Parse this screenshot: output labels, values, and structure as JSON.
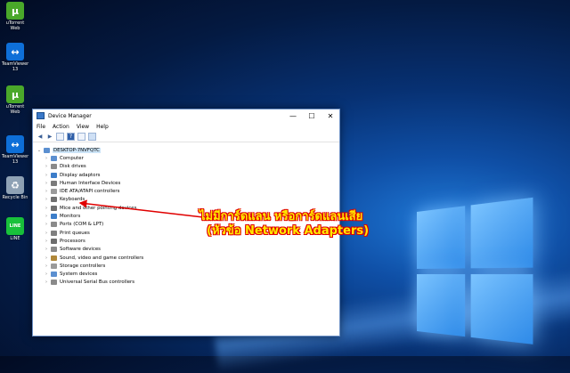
{
  "desktop": {
    "icons": [
      {
        "label": "uTorrent Web",
        "icon": "utorrent-icon",
        "color": "#4aa82a",
        "glyph": "µ"
      },
      {
        "label": "TeamViewer 13",
        "icon": "teamviewer-icon",
        "color": "#0e6fd8",
        "glyph": "↔"
      },
      {
        "label": "uTorrent Web",
        "icon": "utorrent-icon",
        "color": "#4aa82a",
        "glyph": "µ"
      },
      {
        "label": "TeamViewer 13",
        "icon": "teamviewer-icon",
        "color": "#0e6fd8",
        "glyph": "↔"
      },
      {
        "label": "Recycle Bin",
        "icon": "recycle-bin-icon",
        "color": "#8fa2b5",
        "glyph": "♻"
      },
      {
        "label": "LINE",
        "icon": "line-icon",
        "color": "#19c13b",
        "glyph": "LINE"
      }
    ]
  },
  "window": {
    "title": "Device Manager",
    "controls": {
      "minimize": "—",
      "maximize": "☐",
      "close": "✕"
    },
    "menu": [
      "File",
      "Action",
      "View",
      "Help"
    ],
    "toolbar": [
      "back-icon",
      "forward-icon",
      "properties-icon",
      "help-icon",
      "scan-icon",
      "monitor-icon"
    ],
    "root": "DESKTOP-7NVFQTC",
    "devices": [
      {
        "label": "Computer",
        "icon": "computer-icon",
        "color": "#5b8fd0"
      },
      {
        "label": "Disk drives",
        "icon": "disk-icon",
        "color": "#8a8a8a"
      },
      {
        "label": "Display adaptors",
        "icon": "display-icon",
        "color": "#3c7dc9"
      },
      {
        "label": "Human Interface Devices",
        "icon": "hid-icon",
        "color": "#7a7a7a"
      },
      {
        "label": "IDE ATA/ATAPI controllers",
        "icon": "ide-icon",
        "color": "#9a9a9a"
      },
      {
        "label": "Keyboards",
        "icon": "keyboard-icon",
        "color": "#6f6f6f"
      },
      {
        "label": "Mice and other pointing devices",
        "icon": "mouse-icon",
        "color": "#6f6f6f"
      },
      {
        "label": "Monitors",
        "icon": "monitor-icon",
        "color": "#3c7dc9"
      },
      {
        "label": "Ports (COM & LPT)",
        "icon": "port-icon",
        "color": "#8a8a8a"
      },
      {
        "label": "Print queues",
        "icon": "printer-icon",
        "color": "#7f7f7f"
      },
      {
        "label": "Processors",
        "icon": "processor-icon",
        "color": "#6d6d6d"
      },
      {
        "label": "Software devices",
        "icon": "software-device-icon",
        "color": "#8a8a8a"
      },
      {
        "label": "Sound, video and game controllers",
        "icon": "sound-icon",
        "color": "#b0883a"
      },
      {
        "label": "Storage controllers",
        "icon": "storage-icon",
        "color": "#9a9a9a"
      },
      {
        "label": "System devices",
        "icon": "system-icon",
        "color": "#5b8fd0"
      },
      {
        "label": "Universal Serial Bus controllers",
        "icon": "usb-icon",
        "color": "#8a8a8a"
      }
    ]
  },
  "annotation": {
    "line1": "ไม่มีการ์ดแลน หรือการ์ดแลนเสีย",
    "line2": "(หัวข้อ Network Adapters)",
    "text_color": "#ffea00",
    "outline_color": "#e00000"
  }
}
